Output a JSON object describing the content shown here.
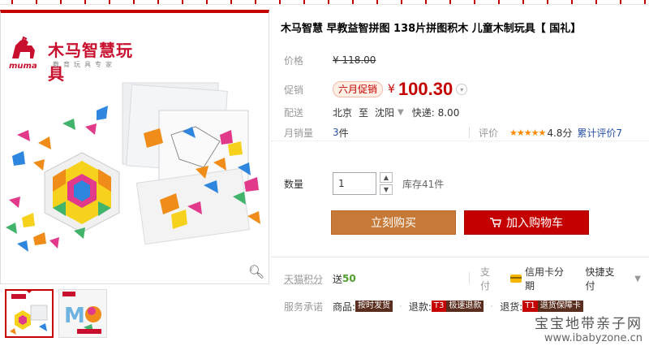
{
  "product": {
    "title": "木马智慧 早教益智拼图 138片拼图积木 儿童木制玩具【 国礼】",
    "brand_name": "木马智慧玩具",
    "brand_tagline": "教育玩具专家",
    "brand_latin": "muma"
  },
  "price": {
    "label": "价格",
    "original": "¥ 118.00",
    "promo_label": "促销",
    "promo_tag": "六月促销",
    "currency": "¥",
    "promo_value": "100.30"
  },
  "shipping": {
    "label": "配送",
    "from": "北京",
    "to_word": "至",
    "to": "沈阳",
    "express": "快递: 8.00"
  },
  "sales": {
    "label": "月销量",
    "count": "3",
    "unit": "件",
    "rating_label": "评价",
    "stars": "★★★★★",
    "score": "4.8分",
    "total_reviews": "累计评价7"
  },
  "quantity": {
    "label": "数量",
    "value": "1",
    "stock": "库存41件"
  },
  "buttons": {
    "buy_now": "立刻购买",
    "add_cart": "加入购物车"
  },
  "service": {
    "points_label": "天猫积分",
    "points_give": "送",
    "points_value": "50",
    "pay_label": "支付",
    "pay_installment": "信用卡分期",
    "pay_quick": "快捷支付",
    "promise_label": "服务承诺",
    "goods_label": "商品:",
    "goods_tag": "按时发货",
    "refund_label": "退款:",
    "refund_t3": "T3",
    "refund_tag": "极速退款",
    "return_label": "退货:",
    "return_t1": "T1",
    "return_tag": "退货保障卡"
  },
  "watermark": {
    "name": "宝宝地带亲子网",
    "url": "www.ibabyzone.cn"
  },
  "colors": {
    "tmall_red": "#c40000",
    "buy_orange": "#c77a38"
  }
}
